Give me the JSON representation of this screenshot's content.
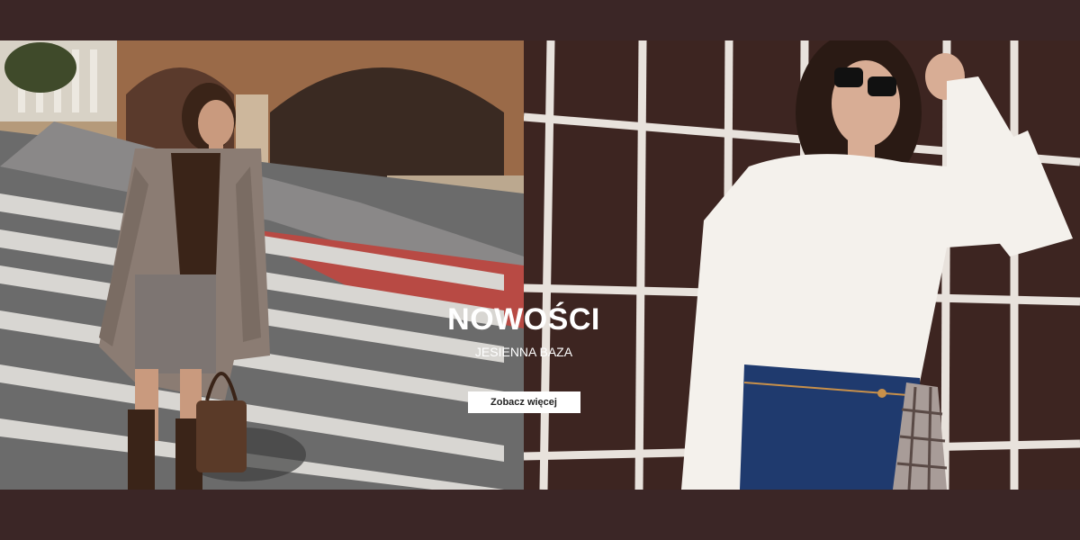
{
  "banner": {
    "headline": "NOWOŚCI",
    "subheadline": "JESIENNA BAZA",
    "cta_label": "Zobacz więcej"
  },
  "colors": {
    "background": "#3b2626",
    "text": "#ffffff",
    "button_bg": "#ffffff",
    "button_text": "#222222"
  }
}
